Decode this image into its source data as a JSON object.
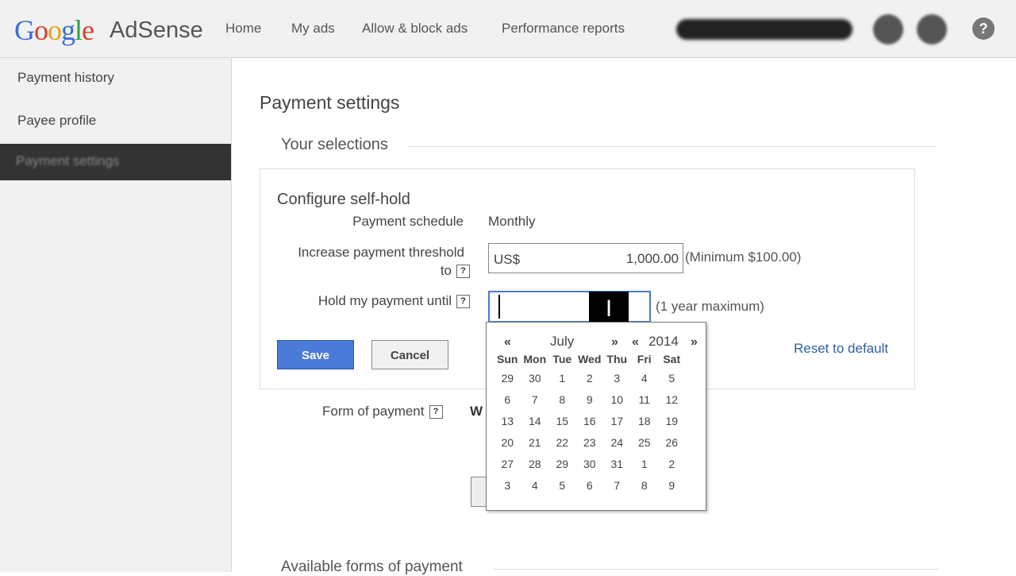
{
  "header": {
    "brand_google": [
      "G",
      "o",
      "o",
      "g",
      "l",
      "e"
    ],
    "brand_product": "AdSense",
    "nav": [
      "Home",
      "My ads",
      "Allow & block ads",
      "Performance reports"
    ],
    "help_label": "?"
  },
  "sidebar": {
    "items": [
      "Payment history",
      "Payee profile"
    ],
    "active_item": "Payment settings"
  },
  "main": {
    "page_title": "Payment settings",
    "section_title": "Your selections",
    "self_hold": {
      "title": "Configure self-hold",
      "schedule_label": "Payment schedule",
      "schedule_value": "Monthly",
      "threshold_label_line1": "Increase payment threshold",
      "threshold_label_line2": "to",
      "threshold_currency": "US$",
      "threshold_value": "1,000.00",
      "threshold_hint": "(Minimum $100.00)",
      "hold_label": "Hold my payment until",
      "hold_value": "",
      "hold_hint": "(1 year maximum)",
      "save_label": "Save",
      "cancel_label": "Cancel",
      "reset_label": "Reset to default"
    },
    "form_of_payment_label": "Form of payment",
    "form_of_payment_value": "W",
    "available_title": "Available forms of payment"
  },
  "calendar": {
    "prev_month": "«",
    "month": "July",
    "next_month": "»",
    "prev_year": "«",
    "year": "2014",
    "next_year": "»",
    "weekdays": [
      "Sun",
      "Mon",
      "Tue",
      "Wed",
      "Thu",
      "Fri",
      "Sat"
    ],
    "weeks": [
      [
        "29",
        "30",
        "1",
        "2",
        "3",
        "4",
        "5"
      ],
      [
        "6",
        "7",
        "8",
        "9",
        "10",
        "11",
        "12"
      ],
      [
        "13",
        "14",
        "15",
        "16",
        "17",
        "18",
        "19"
      ],
      [
        "20",
        "21",
        "22",
        "23",
        "24",
        "25",
        "26"
      ],
      [
        "27",
        "28",
        "29",
        "30",
        "31",
        "1",
        "2"
      ],
      [
        "3",
        "4",
        "5",
        "6",
        "7",
        "8",
        "9"
      ]
    ]
  },
  "colors": {
    "accent": "#4a7bd8",
    "link": "#2f5fa8",
    "sidebar_active": "#333333"
  },
  "icons": {
    "help": "question-circle-icon",
    "field_help": "question-box-icon",
    "cursor": "text-cursor-icon"
  }
}
